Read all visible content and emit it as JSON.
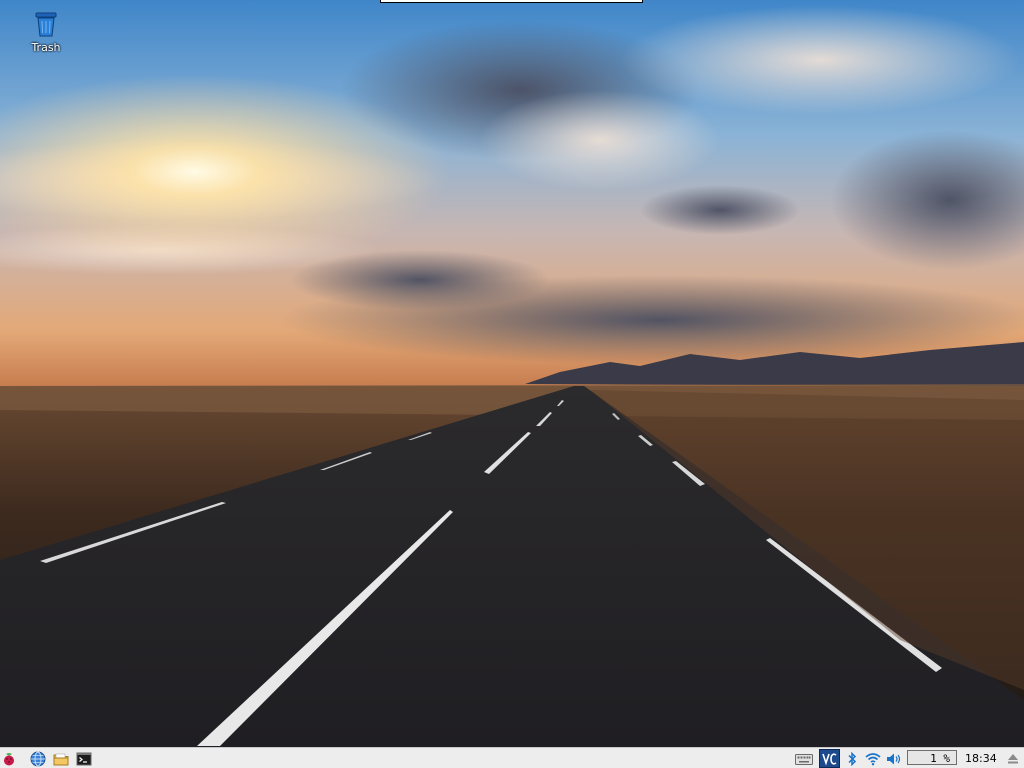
{
  "desktop": {
    "icons": [
      {
        "label": "Trash",
        "icon": "trash-icon"
      }
    ],
    "wallpaper": "road-sunset"
  },
  "taskbar": {
    "launchers": [
      {
        "icon": "raspberry-menu-icon"
      },
      {
        "icon": "web-browser-icon"
      },
      {
        "icon": "file-manager-icon"
      },
      {
        "icon": "terminal-icon"
      }
    ],
    "tray": {
      "keyboard": "keyboard-icon",
      "vnc": "vnc-icon",
      "bluetooth": "bluetooth-icon",
      "wifi": "wifi-icon",
      "volume": "volume-icon",
      "cpu_usage": "1 %",
      "clock": "18:34",
      "eject": "eject-icon"
    }
  },
  "colors": {
    "taskbar_bg": "#ededed",
    "accent_blue": "#1a73c8",
    "vnc_bg": "#1c4a8c"
  }
}
